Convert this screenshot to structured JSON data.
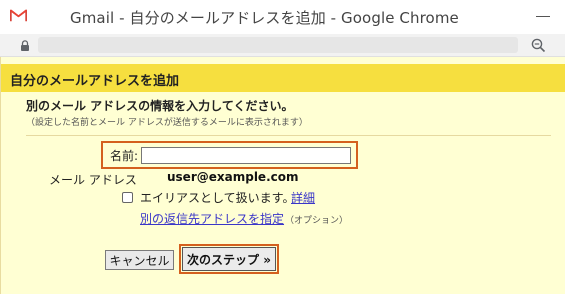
{
  "window": {
    "title": "Gmail - 自分のメールアドレスを追加 - Google Chrome",
    "logo_icon": "gmail-logo-icon",
    "controls": [
      "minimize-icon"
    ]
  },
  "addressbar": {
    "icons": [
      "lock-icon",
      "zoom-icon"
    ],
    "url": ""
  },
  "dialog": {
    "title": "自分のメールアドレスを追加",
    "section_title": "別のメール アドレスの情報を入力してください。",
    "section_subtitle": "（設定した名前とメール アドレスが送信するメールに表示されます）",
    "name_label": "名前:",
    "name_value": "",
    "email_label": "メール アドレス",
    "email_value": "user@example.com",
    "alias_label": "エイリアスとして扱います。",
    "alias_link": "詳細",
    "alias_checked": false,
    "reply_link": "別の返信先アドレスを指定",
    "reply_option": "（オプション）",
    "cancel_label": "キャンセル",
    "next_label": "次のステップ »"
  },
  "colors": {
    "header_bg": "#f6df3f",
    "page_bg": "#ffffd3",
    "highlight": "#d4601e",
    "link": "#3a36c8"
  }
}
